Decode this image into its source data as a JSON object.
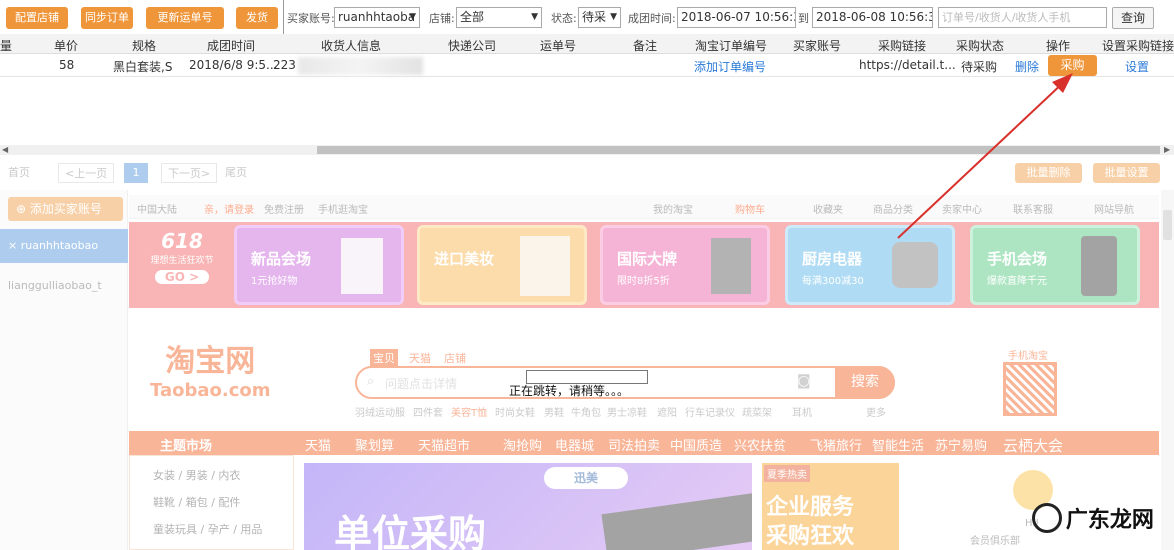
{
  "toolbar": {
    "btn_config_store": "配置店铺",
    "btn_sync_orders": "同步订单",
    "btn_update_tracking": "更新运单号",
    "btn_ship": "发货",
    "buyer_account_label": "买家账号:",
    "buyer_account_value": "ruanhhtaoba",
    "store_label": "店铺:",
    "store_value": "全部",
    "status_label": "状态:",
    "status_value": "待采",
    "deal_time_label": "成团时间:",
    "time_from": "2018-06-07 10:56:37",
    "to_label": "到",
    "time_to": "2018-06-08 10:56:37",
    "search_placeholder": "订单号/收货人/收货人手机",
    "btn_query": "查询"
  },
  "table": {
    "headers": [
      "量",
      "单价",
      "规格",
      "成团时间",
      "收货人信息",
      "快递公司",
      "运单号",
      "备注",
      "淘宝订单编号",
      "买家账号",
      "采购链接",
      "采购状态",
      "操作",
      "设置采购链接"
    ],
    "row": {
      "qty": "",
      "price": "58",
      "spec": "黑白套装,S",
      "deal_time": "2018/6/8 9:5...",
      "recipient": "223",
      "courier": "",
      "tracking": "",
      "note": "",
      "add_order_link": "添加订单编号",
      "buyer_account": "",
      "purchase_link": "https://detail.t...",
      "purchase_status": "待采购",
      "delete_label": "删除",
      "purchase_btn": "采购",
      "settings_link": "设置"
    }
  },
  "pager": {
    "first": "首页",
    "prev": "<上一页",
    "current": "1",
    "next": "下一页>",
    "last": "尾页",
    "btn_batch_delete": "批量删除",
    "btn_batch_set": "批量设置"
  },
  "sidebar": {
    "add_buyer_btn": "添加买家账号",
    "items": [
      "ruanhhtaobao",
      "lianggulliaobao_t"
    ]
  },
  "taobao": {
    "topbar_left": [
      "中国大陆",
      "亲，请登录",
      "免费注册",
      "手机逛淘宝"
    ],
    "topbar_right": [
      "我的淘宝",
      "购物车",
      "收藏夹",
      "商品分类",
      "卖家中心",
      "联系客服",
      "网站导航"
    ],
    "promo_badge": "618",
    "promo_sub": "理想生活狂欢节",
    "promo_go": "GO >",
    "banners": [
      {
        "title": "新品会场",
        "sub": "1元抢好物"
      },
      {
        "title": "进口美妆",
        "sub": ""
      },
      {
        "title": "国际大牌",
        "sub": "限时8折5折"
      },
      {
        "title": "厨房电器",
        "sub": "每满300减30"
      },
      {
        "title": "手机会场",
        "sub": "爆款直降千元"
      }
    ],
    "logo_cn": "淘宝网",
    "logo_en": "Taobao.com",
    "search_tabs": [
      "宝贝",
      "天猫",
      "店铺"
    ],
    "search_placeholder": "问题点击详情",
    "search_btn": "搜索",
    "hot_words": [
      "羽绒运动服",
      "四件套",
      "美容T恤",
      "时尚女鞋",
      "男鞋",
      "牛角包",
      "男士凉鞋",
      "遮阳",
      "行车记录仪",
      "疏菜架",
      "耳机"
    ],
    "more": "更多",
    "qr_label": "手机淘宝",
    "nav_main": "主题市场",
    "nav_items": [
      "天猫",
      "聚划算",
      "天猫超市",
      "淘抢购",
      "电器城",
      "司法拍卖",
      "中国质造",
      "兴农扶贫",
      "飞猪旅行",
      "智能生活",
      "苏宁易购",
      "云栖大会"
    ],
    "side_cats": [
      "女装 / 男装 / 内衣",
      "鞋靴 / 箱包 / 配件",
      "童装玩具 / 孕产 / 用品"
    ],
    "center_brand": "迅美",
    "center_big": "单位采购",
    "right_tag": "夏季热卖",
    "right_big": "企业服务",
    "right_big2": "采购狂欢",
    "hi_label": "Hi!",
    "member_text": "会员俱乐部"
  },
  "redirect_msg": "正在跳转，请稍等。。。",
  "watermark": "广东龙网"
}
